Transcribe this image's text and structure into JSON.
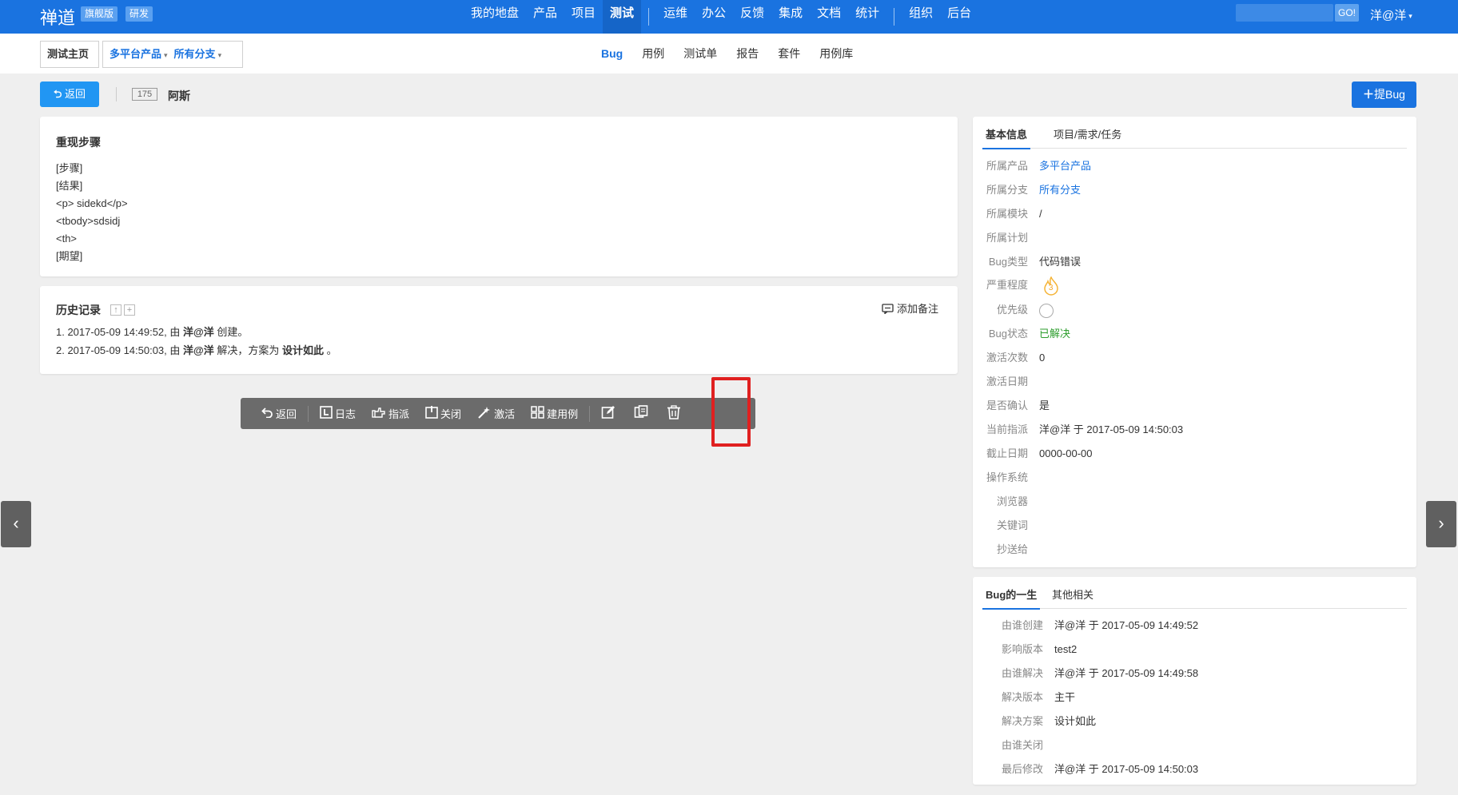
{
  "brand": {
    "name": "禅道",
    "badge_edition": "旗舰版",
    "badge_dev": "研发"
  },
  "main_nav": [
    {
      "label": "我的地盘"
    },
    {
      "label": "产品"
    },
    {
      "label": "项目"
    },
    {
      "label": "测试",
      "active": true
    },
    {
      "label": "运维"
    },
    {
      "label": "办公"
    },
    {
      "label": "反馈"
    },
    {
      "label": "集成"
    },
    {
      "label": "文档"
    },
    {
      "label": "统计"
    },
    {
      "label": "组织"
    },
    {
      "label": "后台"
    }
  ],
  "search": {
    "placeholder": "",
    "go_label": "GO!"
  },
  "user": {
    "name": "洋@洋"
  },
  "breadcrumb": {
    "home": "测试主页",
    "product": "多平台产品",
    "branch": "所有分支"
  },
  "sub_nav": [
    {
      "label": "Bug",
      "active": true
    },
    {
      "label": "用例"
    },
    {
      "label": "测试单"
    },
    {
      "label": "报告"
    },
    {
      "label": "套件"
    },
    {
      "label": "用例库"
    }
  ],
  "title_row": {
    "back_label": "返回",
    "bug_id": "175",
    "bug_title": "阿斯",
    "new_bug_label": "提Bug"
  },
  "steps": {
    "title": "重现步骤",
    "lines": [
      "[步骤]",
      "[结果]",
      "<p> sidekd</p>",
      "<tbody>sdsidj",
      "<th>",
      "[期望]"
    ]
  },
  "history": {
    "title": "历史记录",
    "add_note_label": "添加备注",
    "entries": [
      {
        "prefix": "1. 2017-05-09 14:49:52, 由 ",
        "actor": "洋@洋",
        "action": " 创建。",
        "extra": "",
        "extra_bold": ""
      },
      {
        "prefix": "2. 2017-05-09 14:50:03, 由 ",
        "actor": "洋@洋",
        "action": " 解决，方案为 ",
        "extra_bold": "设计如此",
        "extra": " 。"
      }
    ]
  },
  "toolbar": {
    "back": "返回",
    "log": "日志",
    "assign": "指派",
    "close": "关闭",
    "activate": "激活",
    "create_case": "建用例"
  },
  "basic_info": {
    "tab_basic": "基本信息",
    "tab_project": "项目/需求/任务",
    "fields": [
      {
        "label": "所属产品",
        "value": "多平台产品",
        "style": "link"
      },
      {
        "label": "所属分支",
        "value": "所有分支",
        "style": "link"
      },
      {
        "label": "所属模块",
        "value": "/"
      },
      {
        "label": "所属计划",
        "value": ""
      },
      {
        "label": "Bug类型",
        "value": "代码错误"
      },
      {
        "label": "严重程度",
        "value": "3",
        "style": "severity"
      },
      {
        "label": "优先级",
        "value": "",
        "style": "priority"
      },
      {
        "label": "Bug状态",
        "value": "已解决",
        "style": "green"
      },
      {
        "label": "激活次数",
        "value": "0"
      },
      {
        "label": "激活日期",
        "value": ""
      },
      {
        "label": "是否确认",
        "value": "是"
      },
      {
        "label": "当前指派",
        "value": "洋@洋 于 2017-05-09 14:50:03"
      },
      {
        "label": "截止日期",
        "value": "0000-00-00"
      },
      {
        "label": "操作系统",
        "value": ""
      },
      {
        "label": "浏览器",
        "value": ""
      },
      {
        "label": "关键词",
        "value": ""
      },
      {
        "label": "抄送给",
        "value": ""
      }
    ]
  },
  "life": {
    "tab_life": "Bug的一生",
    "tab_other": "其他相关",
    "fields": [
      {
        "label": "由谁创建",
        "value": "洋@洋 于 2017-05-09 14:49:52"
      },
      {
        "label": "影响版本",
        "value": "test2"
      },
      {
        "label": "由谁解决",
        "value": "洋@洋 于 2017-05-09 14:49:58"
      },
      {
        "label": "解决版本",
        "value": "主干"
      },
      {
        "label": "解决方案",
        "value": "设计如此"
      },
      {
        "label": "由谁关闭",
        "value": ""
      },
      {
        "label": "最后修改",
        "value": "洋@洋 于 2017-05-09 14:50:03"
      }
    ]
  },
  "colors": {
    "primary": "#1a73e0",
    "toolbar_bg": "#6b6b6b",
    "highlight": "#e02020",
    "status_resolved": "#2e9e2e"
  }
}
